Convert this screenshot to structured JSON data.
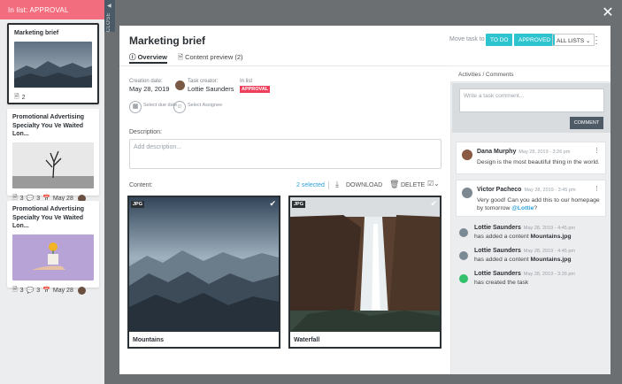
{
  "list_header": "In list: APPROVAL",
  "close_tab": "CLOSE",
  "cards": [
    {
      "title": "Marketing brief",
      "files": "2"
    },
    {
      "title": "Promotional Advertising Specialty You Ve Waited Lon...",
      "files": "3",
      "comments": "3",
      "date": "May 28"
    },
    {
      "title": "Promotional Advertising Specialty You Ve Waited Lon...",
      "files": "3",
      "comments": "3",
      "date": "May 28"
    }
  ],
  "modal": {
    "title": "Marketing brief",
    "move_label": "Move task to",
    "btn_todo": "TO DO",
    "btn_approved": "APPROVED",
    "btn_all_lists": "ALL LISTS",
    "tabs": [
      "Overview",
      "Content preview (2)"
    ],
    "creation_label": "Creation date:",
    "creation_value": "May 28, 2019",
    "creator_label": "Task creator:",
    "creator_value": "Lottie Saunders",
    "inlist_label": "In list",
    "inlist_value": "APPROVAL",
    "due_label": "Select due date",
    "assignee_label": "Select Assignee",
    "description_label": "Description:",
    "description_placeholder": "Add description...",
    "content_label": "Content:",
    "selected_label": "2 selected",
    "download_label": "DOWNLOAD",
    "delete_label": "DELETE",
    "media": [
      {
        "tag": "JPG",
        "caption": "Mountains"
      },
      {
        "tag": "JPG",
        "caption": "Waterfall"
      }
    ]
  },
  "activity": {
    "header": "Activities / Comments",
    "placeholder": "Write a task comment...",
    "comment_button": "COMMENT",
    "comments": [
      {
        "name": "Dana Murphy",
        "time": "May 28, 2019 - 3:26 pm",
        "text": "Design is the most beautiful thing in the world."
      },
      {
        "name": "Victor Pacheco",
        "time": "May 28, 2019 - 3:45 pm",
        "text_pre": "Very good! Can you add this to our homepage by tomorrow ",
        "mention": "@Lottie",
        "text_post": "?"
      }
    ],
    "logs": [
      {
        "name": "Lottie Saunders",
        "time": "May 28, 2019 - 4:45 pm",
        "text": "has added a content ",
        "bold": "Mountains.jpg"
      },
      {
        "name": "Lottie Saunders",
        "time": "May 28, 2019 - 4:45 pm",
        "text": "has added a content ",
        "bold": "Mountains.jpg"
      },
      {
        "name": "Lottie Saunders",
        "time": "May 28, 2019 - 3:26 pm",
        "text": "has created the task",
        "bold": ""
      }
    ]
  },
  "colors": {
    "teal": "#2ec4cf",
    "pink": "#f26d7d",
    "red_badge": "#ef3f5a",
    "dark": "#2b3035"
  }
}
